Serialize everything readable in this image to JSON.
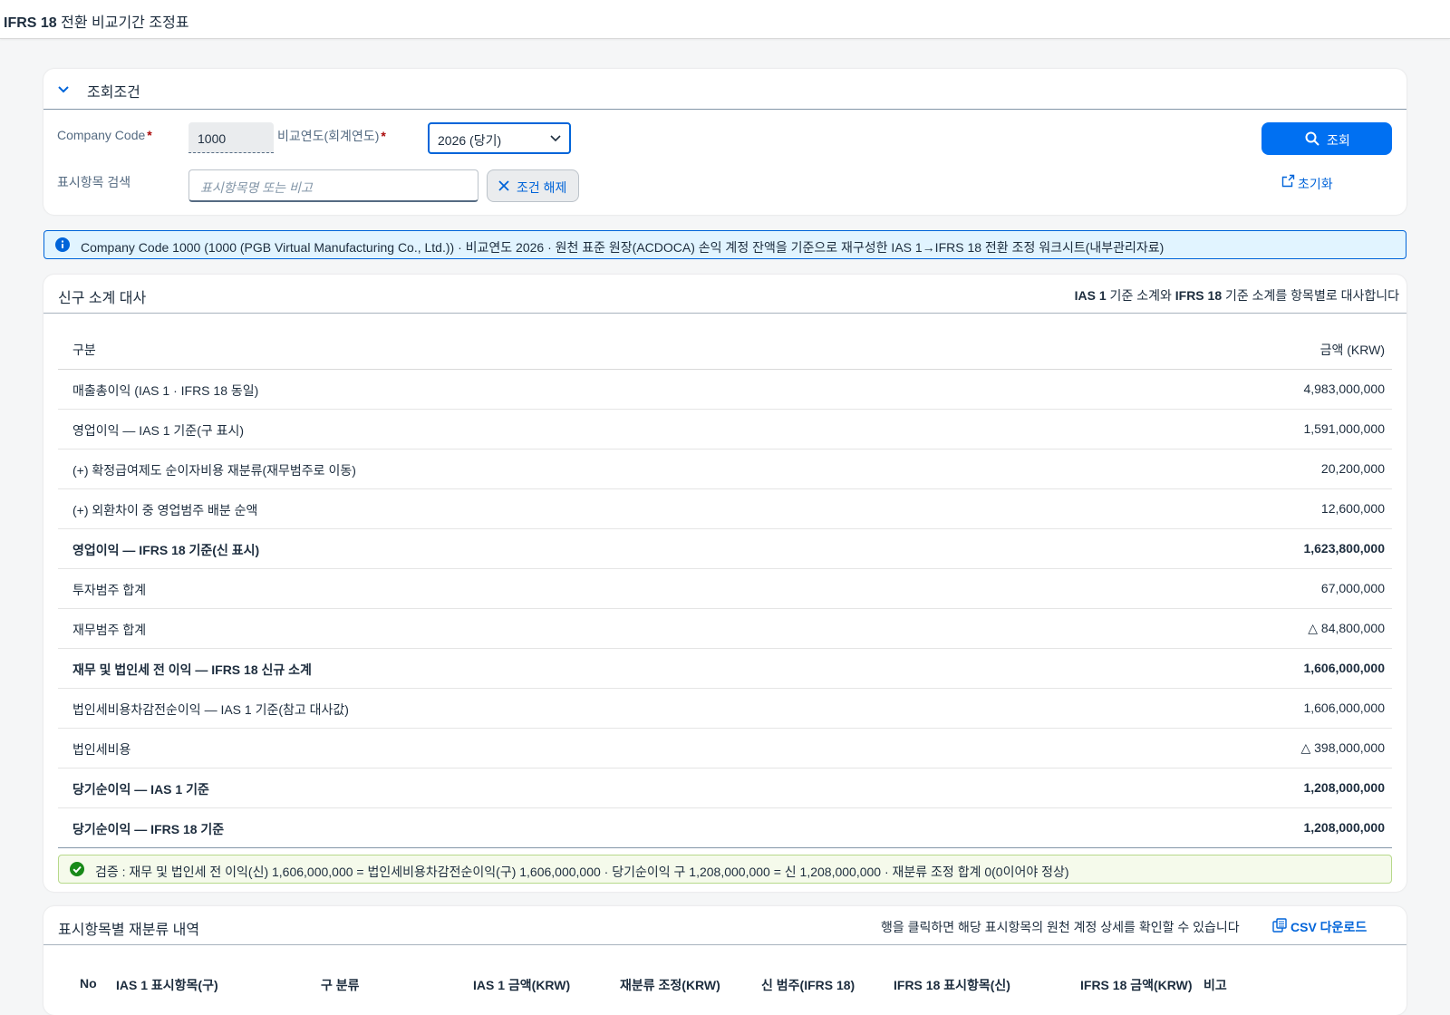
{
  "header": {
    "title_bold": "IFRS 18",
    "title_rest": " 전환 비교기간 조정표"
  },
  "filter": {
    "title": "조회조건",
    "company_code_label": "Company Code",
    "company_code_value": "1000",
    "year_label": "비교연도(회계연도)",
    "year_value": "2026 (당기)",
    "item_search_label": "표시항목 검색",
    "item_search_placeholder": "표시항목명 또는 비고",
    "clear_label": "조건 해제",
    "search_label": "조회",
    "reset_label": "초기화",
    "required_mark": "*"
  },
  "info": {
    "text": "Company Code 1000 (1000 (PGB Virtual Manufacturing Co., Ltd.)) · 비교연도 2026 · 원천 표준 원장(ACDOCA) 손익 계정 잔액을 기준으로 재구성한 IAS 1→IFRS 18 전환 조정 워크시트(내부관리자료)"
  },
  "recon": {
    "title": "신구 소계 대사",
    "subtitle_b1": "IAS 1",
    "subtitle_t1": " 기준 소계와 ",
    "subtitle_b2": "IFRS 18",
    "subtitle_t2": " 기준 소계를 항목별로 대사합니다",
    "col_label": "구분",
    "col_amount": "금액 (KRW)",
    "rows": [
      {
        "label": "매출총이익 (IAS 1 · IFRS 18 동일)",
        "amount": "4,983,000,000"
      },
      {
        "label": "영업이익 — IAS 1 기준(구 표시)",
        "amount": "1,591,000,000"
      },
      {
        "label": "(+) 확정급여제도 순이자비용 재분류(재무범주로 이동)",
        "amount": "20,200,000"
      },
      {
        "label": "(+) 외환차이 중 영업범주 배분 순액",
        "amount": "12,600,000"
      },
      {
        "label": "영업이익 — IFRS 18 기준(신 표시)",
        "amount": "1,623,800,000"
      },
      {
        "label": "투자범주 합계",
        "amount": "67,000,000"
      },
      {
        "label": "재무범주 합계",
        "amount": "△ 84,800,000"
      },
      {
        "label": "재무 및 법인세 전 이익 — IFRS 18 신규 소계",
        "amount": "1,606,000,000"
      },
      {
        "label": "법인세비용차감전순이익 — IAS 1 기준(참고 대사값)",
        "amount": "1,606,000,000"
      },
      {
        "label": "법인세비용",
        "amount": "△ 398,000,000"
      },
      {
        "label": "당기순이익 — IAS 1 기준",
        "amount": "1,208,000,000"
      },
      {
        "label": "당기순이익 — IFRS 18 기준",
        "amount": "1,208,000,000"
      }
    ],
    "validation": "검증 : 재무 및 법인세 전 이익(신) 1,606,000,000 = 법인세비용차감전순이익(구) 1,606,000,000 · 당기순이익 구 1,208,000,000 = 신 1,208,000,000 · 재분류 조정 합계 0(0이어야 정상)"
  },
  "reclass": {
    "title": "표시항목별 재분류 내역",
    "subtitle": "행을 클릭하면 해당 표시항목의 원천 계정 상세를 확인할 수 있습니다",
    "csv_label": "CSV 다운로드",
    "columns": [
      "No",
      "IAS 1 표시항목(구)",
      "구 분류",
      "IAS 1 금액(KRW)",
      "재분류 조정(KRW)",
      "신 범주(IFRS 18)",
      "IFRS 18 표시항목(신)",
      "IFRS 18 금액(KRW)",
      "비고"
    ]
  },
  "colors": {
    "accent": "#0070f2",
    "link": "#0064d9",
    "required": "#aa0808",
    "success": "#188918"
  }
}
